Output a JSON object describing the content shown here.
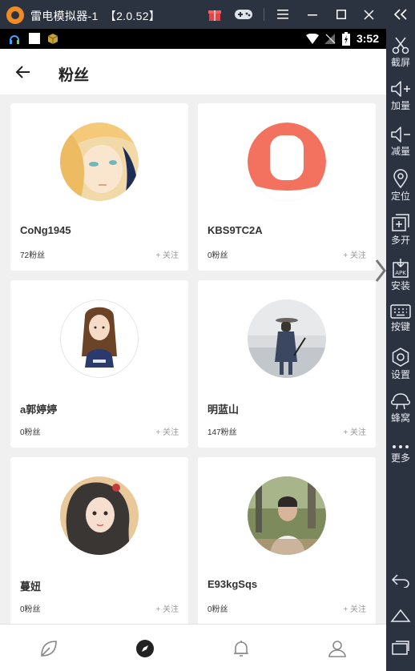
{
  "emulator": {
    "title": "雷电模拟器-1",
    "version": "【2.0.52】"
  },
  "status_bar": {
    "time": "3:52"
  },
  "sidebar": {
    "items": [
      {
        "label": "截屏",
        "icon": "scissors-icon"
      },
      {
        "label": "加量",
        "icon": "volume-up-icon"
      },
      {
        "label": "减量",
        "icon": "volume-down-icon"
      },
      {
        "label": "定位",
        "icon": "location-icon"
      },
      {
        "label": "多开",
        "icon": "multi-instance-icon"
      },
      {
        "label": "安装",
        "icon": "apk-install-icon"
      },
      {
        "label": "按键",
        "icon": "keyboard-icon"
      },
      {
        "label": "设置",
        "icon": "gear-icon"
      },
      {
        "label": "蜂窝",
        "icon": "hive-icon"
      },
      {
        "label": "更多",
        "icon": "more-dots-icon"
      }
    ]
  },
  "page": {
    "title": "粉丝"
  },
  "followers": [
    {
      "name": "CoNg1945",
      "fans": "72粉丝",
      "follow": "关注"
    },
    {
      "name": "KBS9TC2A",
      "fans": "0粉丝",
      "follow": "关注"
    },
    {
      "name": "a郭婷婷",
      "fans": "0粉丝",
      "follow": "关注"
    },
    {
      "name": "明蓝山",
      "fans": "147粉丝",
      "follow": "关注"
    },
    {
      "name": "蔓妞",
      "fans": "0粉丝",
      "follow": "关注"
    },
    {
      "name": "E93kgSqs",
      "fans": "0粉丝",
      "follow": "关注"
    }
  ],
  "bottom_nav": [
    {
      "icon": "leaf-icon"
    },
    {
      "icon": "compass-icon",
      "active": true
    },
    {
      "icon": "bell-icon"
    },
    {
      "icon": "profile-icon"
    }
  ],
  "colors": {
    "accent": "#f3725f",
    "emulator_frame": "#2c3340",
    "page_bg": "#f0f0f0"
  }
}
